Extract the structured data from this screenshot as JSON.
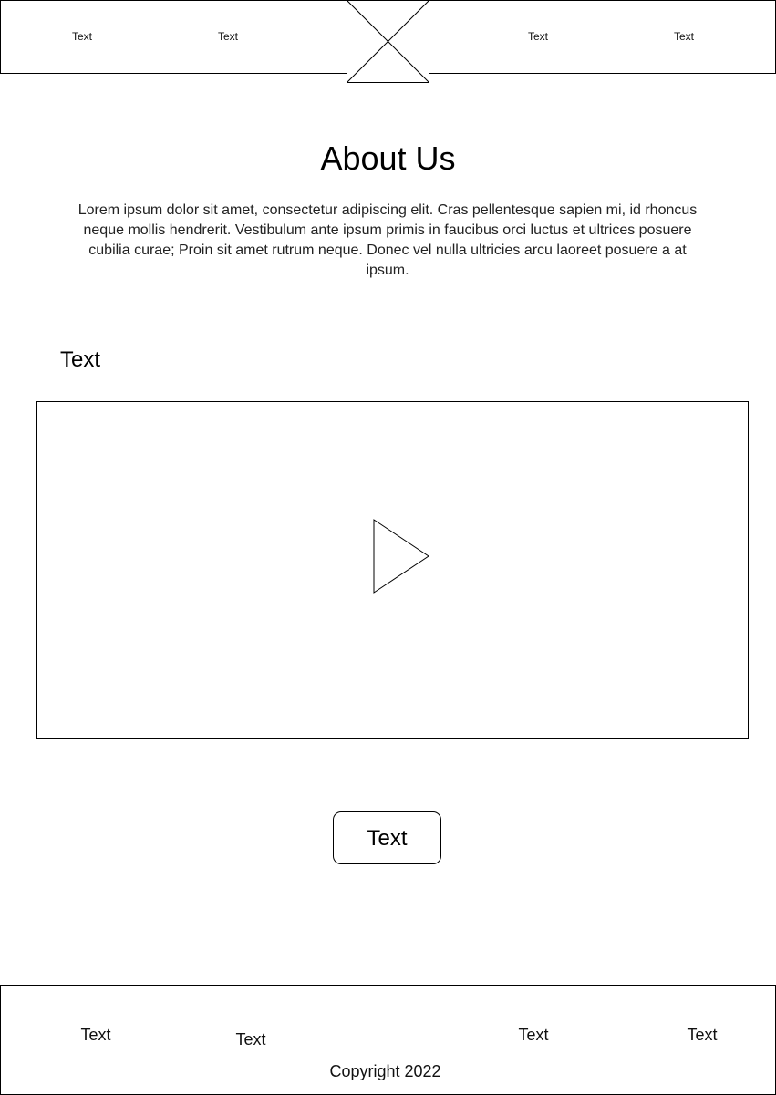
{
  "header": {
    "nav_left": [
      {
        "label": "Text"
      },
      {
        "label": "Text"
      }
    ],
    "nav_right": [
      {
        "label": "Text"
      },
      {
        "label": "Text"
      }
    ],
    "logo_icon": "placeholder-image-icon"
  },
  "main": {
    "title": "About Us",
    "intro": "Lorem ipsum dolor sit amet, consectetur adipiscing elit. Cras pellentesque sapien mi, id rhoncus neque mollis hendrerit. Vestibulum ante ipsum primis in faucibus orci luctus et ultrices posuere cubilia curae; Proin sit amet rutrum neque. Donec vel nulla ultricies arcu laoreet posuere a at ipsum.",
    "section_label": "Text",
    "video": {
      "play_icon": "play-icon"
    },
    "cta_label": "Text"
  },
  "footer": {
    "links": [
      {
        "label": "Text"
      },
      {
        "label": "Text"
      },
      {
        "label": "Text"
      },
      {
        "label": "Text"
      }
    ],
    "copyright": "Copyright 2022"
  },
  "colors": {
    "border": "#000000",
    "background": "#ffffff",
    "text": "#000000"
  }
}
